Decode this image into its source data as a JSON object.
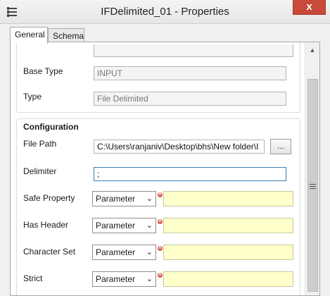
{
  "window": {
    "title": "IFDelimited_01 - Properties",
    "close_glyph": "x"
  },
  "tabs": [
    {
      "label": "General"
    },
    {
      "label": "Schema"
    }
  ],
  "general": {
    "base_type_label": "Base Type",
    "base_type_value": "INPUT",
    "type_label": "Type",
    "type_value": "File Delimited"
  },
  "configuration": {
    "title": "Configuration",
    "file_path_label": "File Path",
    "file_path_value": "C:\\Users\\ranjaniv\\Desktop\\bhs\\New folder\\I",
    "browse_label": "...",
    "delimiter_label": "Delimiter",
    "delimiter_value": ";",
    "rows": [
      {
        "label": "Safe Property",
        "selected": "Parameter"
      },
      {
        "label": "Has Header",
        "selected": "Parameter"
      },
      {
        "label": "Character Set",
        "selected": "Parameter"
      },
      {
        "label": "Strict",
        "selected": "Parameter"
      }
    ]
  },
  "icons": {
    "caret": "chevron-down-icon",
    "required": "error-icon"
  }
}
